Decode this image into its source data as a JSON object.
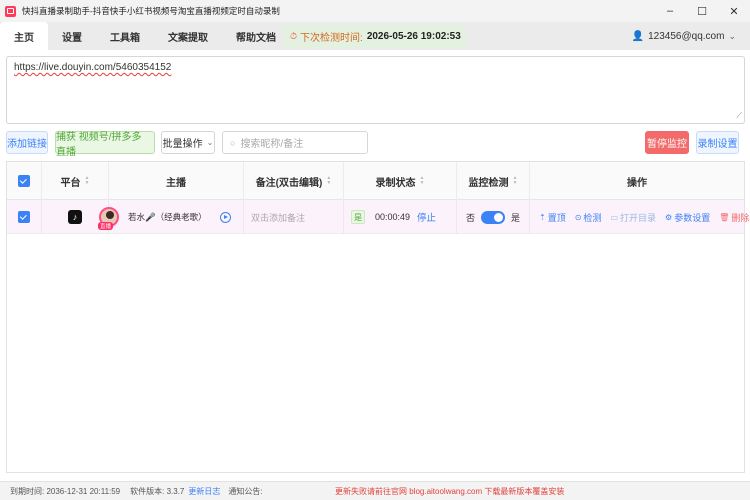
{
  "window": {
    "title": "快抖直播录制助手-抖音快手小红书视频号淘宝直播视频定时自动录制",
    "controls": [
      "–",
      "☐",
      "✕"
    ]
  },
  "menu": {
    "items": [
      "主页",
      "设置",
      "工具箱",
      "文案提取",
      "帮助文档"
    ],
    "active": "主页"
  },
  "next_check": {
    "label": "下次检测时间:",
    "value": "2026-05-26 19:02:53"
  },
  "user": {
    "email": "123456@qq.com"
  },
  "url_input": {
    "value": "https://live.douyin.com/5460354152"
  },
  "toolbar": {
    "add_link": "添加链接",
    "capture": "捕获 视频号/拼多多 直播",
    "batch": "批量操作",
    "search_placeholder": "搜索昵称/备注",
    "pause": "暂停监控",
    "record_settings": "录制设置"
  },
  "table": {
    "headers": {
      "platform": "平台",
      "anchor": "主播",
      "remark": "备注(双击编辑)",
      "status": "录制状态",
      "monitor": "监控检测",
      "action": "操作"
    },
    "rows": [
      {
        "platform": "抖音",
        "live_badge": "直播",
        "anchor_name": "若水🎤（经典老歌）",
        "remark_placeholder": "双击添加备注",
        "rec_badge": "是",
        "rec_time": "00:00:49",
        "stop": "停止",
        "monitor_off": "否",
        "monitor_on": "是",
        "monitor_enabled": true,
        "ops": {
          "pin": "置顶",
          "check": "检测",
          "open_dir": "打开目录",
          "params": "参数设置",
          "delete": "删除"
        }
      }
    ]
  },
  "statusbar": {
    "expire": "到期时间: 2036-12-31 20:11:59",
    "version": "软件版本: 3.3.7",
    "changelog": "更新日志",
    "notice_label": "通知公告:",
    "notice_msg": "更新失败请前往官网 blog.aitoolwang.com 下载最新版本覆盖安装"
  },
  "colors": {
    "accent": "#3b82f6",
    "danger": "#f36a6a",
    "success": "#52a83a"
  }
}
